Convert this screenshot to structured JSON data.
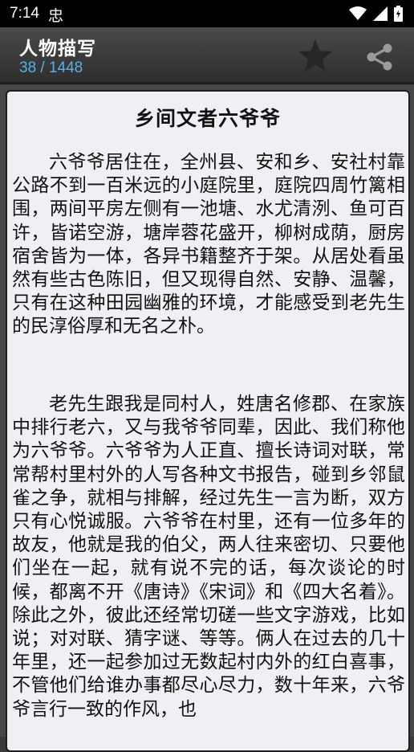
{
  "status_bar": {
    "time": "7:14",
    "app_glyph": "忠",
    "icons": [
      "wifi-icon",
      "signal-icon",
      "battery-icon"
    ]
  },
  "app_bar": {
    "title": "人物描写",
    "counter": "38 / 1448",
    "icons": [
      "star-icon",
      "share-icon"
    ]
  },
  "article": {
    "title": "乡间文者六爷爷",
    "paragraphs": [
      "六爷爷居住在，全州县、安和乡、安社村靠公路不到一百米远的小庭院里，庭院四周竹篱相围，两间平房左侧有一池塘、水尤清洌、鱼可百许，皆诺空游，塘岸蓉花盛开，柳树成荫，厨房宿舍皆为一体，各异书籍整齐于架。从居处看虽然有些古色陈旧，但又现得自然、安静、温馨，只有在这种田园幽雅的环境，才能感受到老先生的民淳俗厚和无名之朴。",
      "老先生跟我是同村人，姓唐名修郡、在家族中排行老六，又与我爷爷同辈，因此、我们称他为六爷爷。六爷爷为人正直、擅长诗词对联，常常帮村里村外的人写各种文书报告，碰到乡邻鼠雀之争，就相与排解，经过先生一言为断，双方只有心悦诚服。六爷爷在村里，还有一位多年的故友，他就是我的伯父，两人往来密切、只要他们坐在一起，就有说不完的话，每次谈论的时候，都离不开《唐诗》《宋词》和《四大名着》。除此之外，彼此还经常切磋一些文字游戏，比如说；对对联、猜字谜、等等。俩人在过去的几十年里，还一起参加过无数起村内外的红白喜事，不管他们给谁办事都尽心尽力，数十年来，六爷爷言行一致的作风，也"
    ]
  },
  "colors": {
    "status_bar": "#000000",
    "app_bar": "#3a3a3a",
    "accent": "#5ab0e6",
    "card": "#eef0f4"
  }
}
